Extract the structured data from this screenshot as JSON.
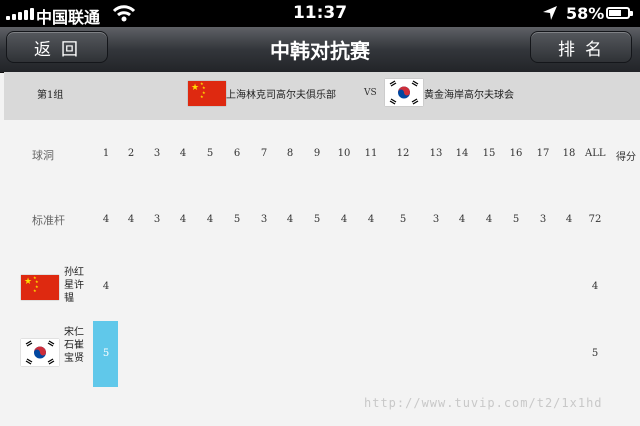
{
  "status": {
    "carrier": "中国联通",
    "time": "11:37",
    "battery": "58%"
  },
  "nav": {
    "back": "返回",
    "title": "中韩对抗赛",
    "rank": "排名"
  },
  "match": {
    "group": "第1组",
    "team1": "上海林克司高尔夫俱乐部",
    "vs": "VS",
    "team2": "黄金海岸高尔夫球会"
  },
  "table": {
    "hole_label": "球洞",
    "par_label": "标准杆",
    "holes": [
      "1",
      "2",
      "3",
      "4",
      "5",
      "6",
      "7",
      "8",
      "9",
      "10",
      "11",
      "12",
      "13",
      "14",
      "15",
      "16",
      "17",
      "18",
      "ALL",
      "得分"
    ],
    "par": [
      "4",
      "4",
      "3",
      "4",
      "4",
      "5",
      "3",
      "4",
      "5",
      "4",
      "4",
      "5",
      "3",
      "4",
      "4",
      "5",
      "3",
      "4",
      "72"
    ],
    "players": [
      {
        "flag": "china-flag-icon",
        "name": "孙红星许韫",
        "score": "4",
        "total": "4"
      },
      {
        "flag": "korea-flag-icon",
        "name": "宋仁石崔宝贤",
        "score": "5",
        "total": "5"
      }
    ]
  },
  "watermark": "http://www.tuvip.com/t2/1x1hd"
}
